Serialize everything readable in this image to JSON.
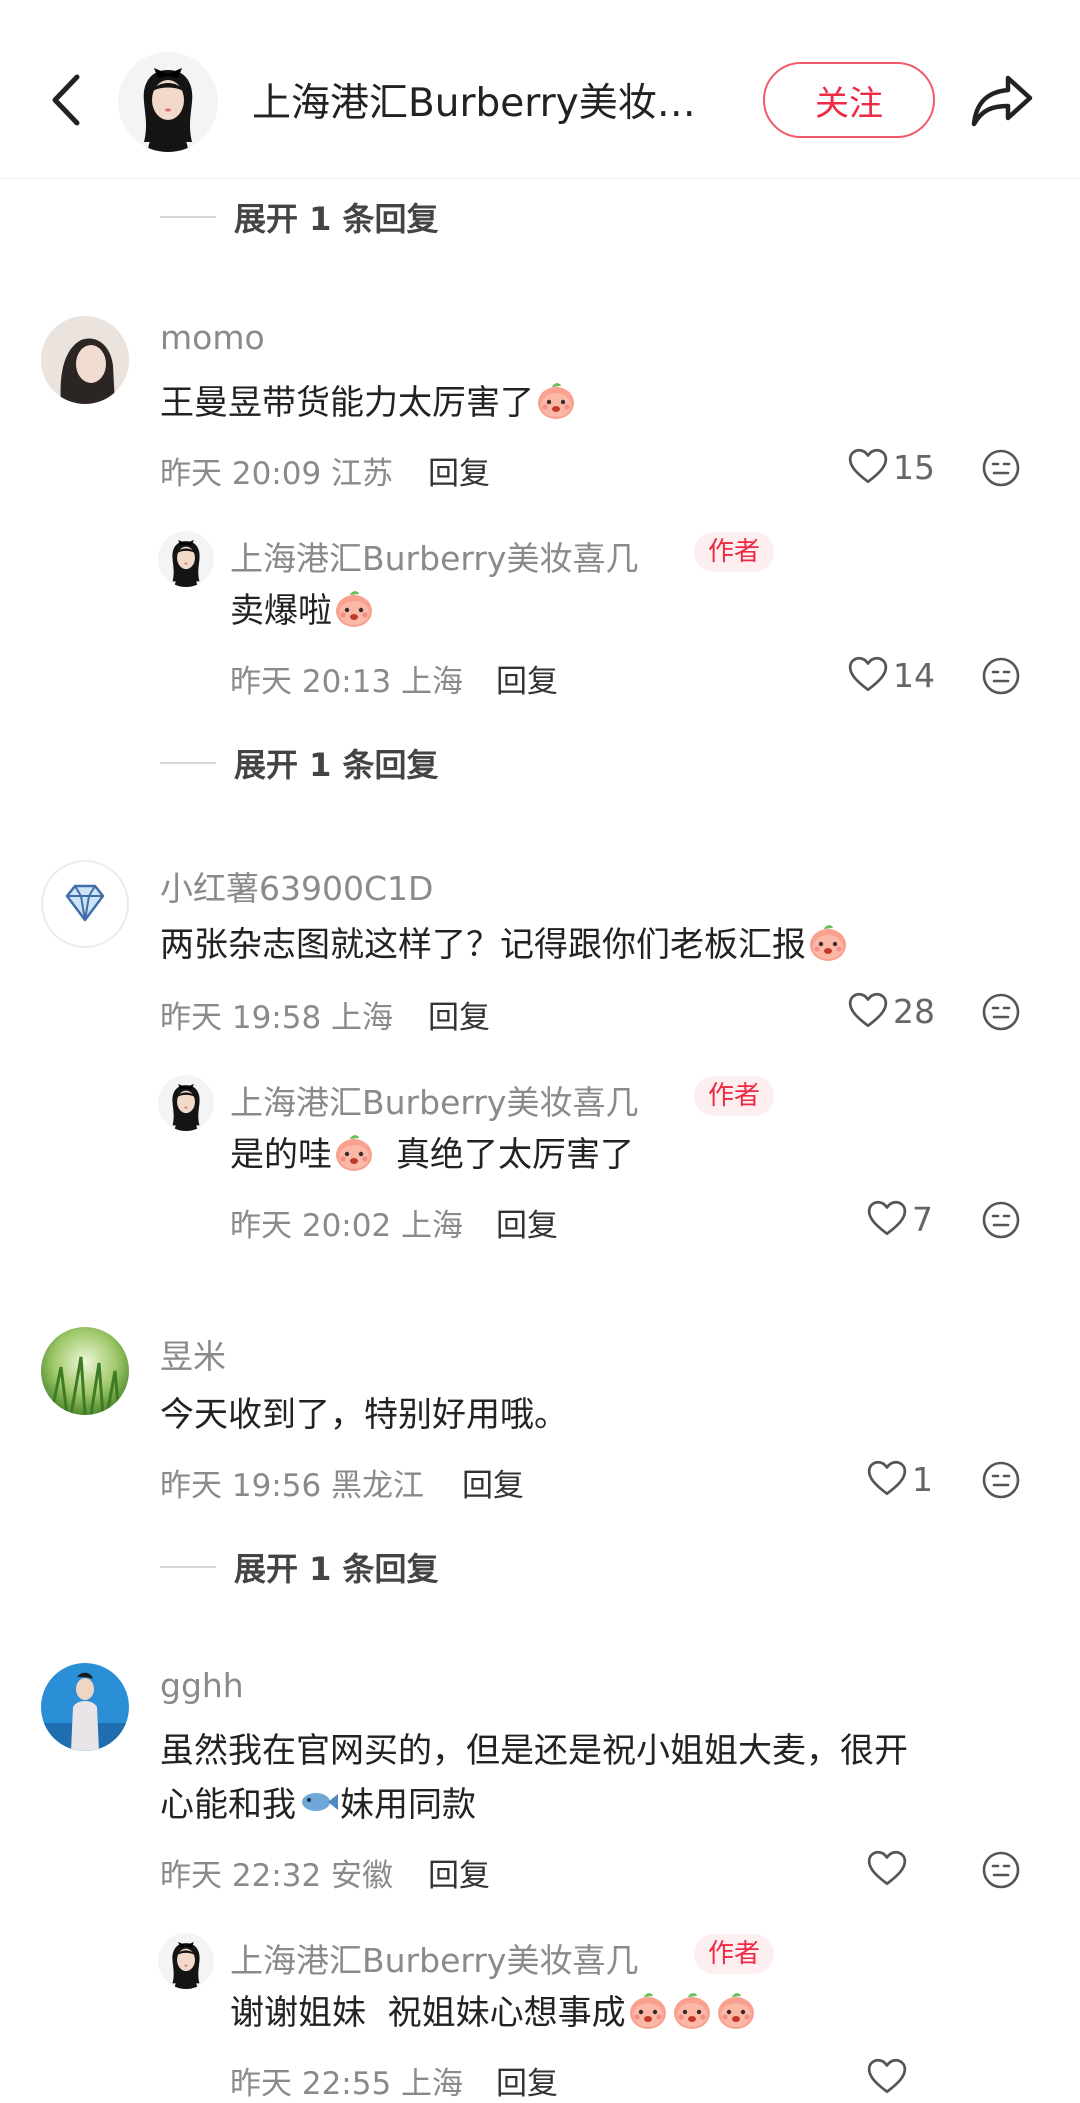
{
  "header": {
    "title": "上海港汇Burberry美妆…",
    "follow_label": "关注"
  },
  "expand_label": "展开 1 条回复",
  "author_tag": "作者",
  "reply_label": "回复",
  "comments": [
    {
      "user": "momo",
      "text": "王曼昱带货能力太厉害了",
      "time": "昨天 20:09 江苏",
      "likes": "15",
      "reply": {
        "user": "上海港汇Burberry美妆喜几",
        "text": "卖爆啦",
        "time": "昨天 20:13 上海",
        "likes": "14"
      }
    },
    {
      "user": "小红薯63900C1D",
      "text": "两张杂志图就这样了？记得跟你们老板汇报",
      "time": "昨天 19:58 上海",
      "likes": "28",
      "reply": {
        "user": "上海港汇Burberry美妆喜几",
        "text_a": "是的哇",
        "text_b": "真绝了太厉害了",
        "time": "昨天 20:02 上海",
        "likes": "7"
      }
    },
    {
      "user": "昱米",
      "text": "今天收到了，特别好用哦。",
      "time": "昨天 19:56 黑龙江",
      "likes": "1"
    },
    {
      "user": "gghh",
      "text_line1": "虽然我在官网买的，但是还是祝小姐姐大麦，很开",
      "text_line2a": "心能和我",
      "text_line2b": "妹用同款",
      "time": "昨天 22:32 安徽",
      "likes": "",
      "reply": {
        "user": "上海港汇Burberry美妆喜几",
        "text": "谢谢姐妹  祝姐妹心想事成",
        "time": "昨天 22:55 上海"
      }
    }
  ],
  "colors": {
    "accent": "#ee2a45",
    "muted": "#8a8a8a",
    "divider": "#eeeeee"
  }
}
